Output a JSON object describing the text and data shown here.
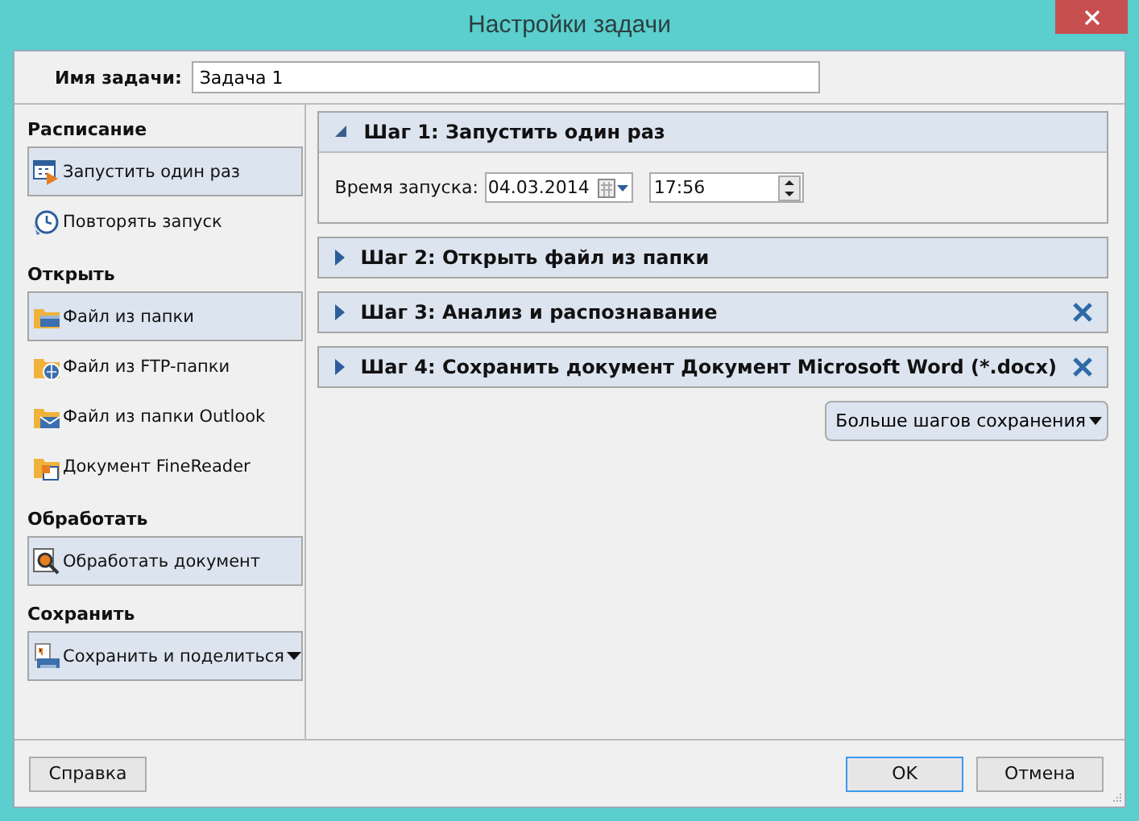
{
  "window": {
    "title": "Настройки задачи"
  },
  "task_name": {
    "label": "Имя задачи:",
    "value": "Задача 1"
  },
  "sidebar": [
    {
      "heading": "Расписание",
      "items": [
        {
          "label": "Запустить один раз",
          "kind": "calendar",
          "selected": true,
          "dropdown": false
        },
        {
          "label": "Повторять запуск",
          "kind": "repeat",
          "selected": false,
          "dropdown": false
        }
      ]
    },
    {
      "heading": "Открыть",
      "items": [
        {
          "label": "Файл из папки",
          "kind": "folder",
          "selected": true,
          "dropdown": false
        },
        {
          "label": "Файл из FTP-папки",
          "kind": "ftp",
          "selected": false,
          "dropdown": false
        },
        {
          "label": "Файл из папки Outlook",
          "kind": "mail",
          "selected": false,
          "dropdown": false
        },
        {
          "label": "Документ FineReader",
          "kind": "document",
          "selected": false,
          "dropdown": false
        }
      ]
    },
    {
      "heading": "Обработать",
      "items": [
        {
          "label": "Обработать документ",
          "kind": "process",
          "selected": true,
          "dropdown": false
        }
      ]
    },
    {
      "heading": "Сохранить",
      "items": [
        {
          "label": "Сохранить и поделиться",
          "kind": "save",
          "selected": true,
          "dropdown": true
        }
      ]
    }
  ],
  "steps": [
    {
      "title": "Шаг 1: Запустить один раз",
      "expanded": true,
      "removable": false,
      "fields": {
        "label": "Время запуска:",
        "date": "04.03.2014",
        "time": "17:56"
      }
    },
    {
      "title": "Шаг 2: Открыть файл из папки",
      "expanded": false,
      "removable": false
    },
    {
      "title": "Шаг 3: Анализ и распознавание",
      "expanded": false,
      "removable": true
    },
    {
      "title": "Шаг 4: Сохранить документ Документ Microsoft Word (*.docx)",
      "expanded": false,
      "removable": true
    }
  ],
  "more_button": "Больше шагов сохранения",
  "buttons": [
    {
      "label": "Справка",
      "kind": "help",
      "default": false
    },
    {
      "label": "OK",
      "kind": "ok",
      "default": true
    },
    {
      "label": "Отмена",
      "kind": "cancel",
      "default": false
    }
  ]
}
